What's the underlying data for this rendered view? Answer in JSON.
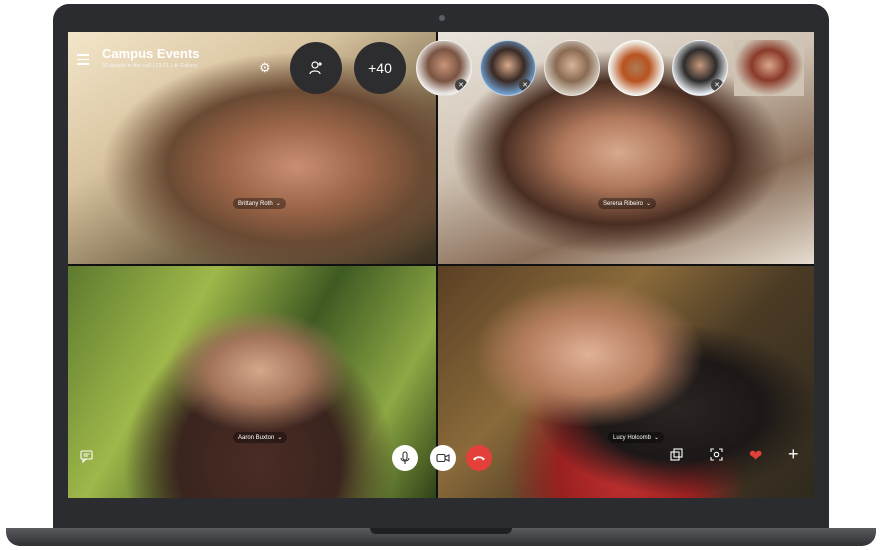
{
  "call": {
    "title": "Campus Events",
    "subtitle": "50 people in the call | 13:21 | ⊕ Gallery",
    "more_count": "+40"
  },
  "participants": [
    {
      "name": "Brittany Roth"
    },
    {
      "name": "Serena Ribeiro"
    },
    {
      "name": "Aaron Buxton"
    },
    {
      "name": "Lucy Holcomb"
    }
  ],
  "icons": {
    "menu": "hamburger-menu-icon",
    "settings": "gear-icon",
    "add_person": "add-person-icon",
    "mic": "microphone-icon",
    "video": "video-camera-icon",
    "hangup": "phone-hangup-icon",
    "chat": "chat-icon",
    "switch": "switch-camera-icon",
    "screenshot": "screenshot-icon",
    "heart": "heart-icon",
    "plus": "plus-icon"
  },
  "colors": {
    "hangup": "#e3403a",
    "heart": "#e3403a",
    "control_bg": "#2d2d2f"
  }
}
